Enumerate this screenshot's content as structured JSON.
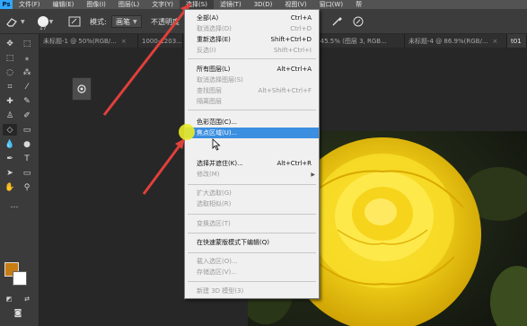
{
  "menubar": {
    "logo": "Ps",
    "items": [
      "文件(F)",
      "编辑(E)",
      "图像(I)",
      "图层(L)",
      "文字(Y)",
      "选择(S)",
      "滤镜(T)",
      "3D(D)",
      "视图(V)",
      "窗口(W)",
      "帮"
    ]
  },
  "options": {
    "brush_size": "17",
    "mode_label": "模式:",
    "mode_value": "画笔",
    "opacity_label": "不透明度"
  },
  "tabs": [
    {
      "label": "未标题-1 @ 50%(RGB/..."
    },
    {
      "label": "1000-1203..."
    },
    {
      "label": "...45.5% (图层 3, RGB..."
    },
    {
      "label": "未标题-4 @ 86.9%(RGB/..."
    },
    {
      "label": "t01"
    }
  ],
  "mini_panel_icon": "layer-comp-icon",
  "dropdown": {
    "items": [
      {
        "label": "全部(A)",
        "shortcut": "Ctrl+A",
        "disabled": false
      },
      {
        "label": "取消选择(D)",
        "shortcut": "Ctrl+D",
        "disabled": true
      },
      {
        "label": "重新选择(E)",
        "shortcut": "Shift+Ctrl+D",
        "disabled": false
      },
      {
        "label": "反选(I)",
        "shortcut": "Shift+Ctrl+I",
        "disabled": true
      },
      {
        "label": "所有图层(L)",
        "shortcut": "Alt+Ctrl+A",
        "disabled": false
      },
      {
        "label": "取消选择图层(S)",
        "shortcut": "",
        "disabled": true
      },
      {
        "label": "查找图层",
        "shortcut": "Alt+Shift+Ctrl+F",
        "disabled": true
      },
      {
        "label": "隔离图层",
        "shortcut": "",
        "disabled": true
      },
      {
        "label": "色彩范围(C)...",
        "shortcut": "",
        "disabled": false
      },
      {
        "label": "焦点区域(U)...",
        "shortcut": "",
        "disabled": false,
        "highlighted": true
      },
      {
        "label": "选择并遮住(K)...",
        "shortcut": "Alt+Ctrl+R",
        "disabled": false
      },
      {
        "label": "修改(M)",
        "shortcut": "",
        "disabled": true,
        "submenu": true
      },
      {
        "label": "扩大选取(G)",
        "shortcut": "",
        "disabled": true
      },
      {
        "label": "选取相似(R)",
        "shortcut": "",
        "disabled": true
      },
      {
        "label": "变换选区(T)",
        "shortcut": "",
        "disabled": true
      },
      {
        "label": "在快速蒙版模式下编辑(Q)",
        "shortcut": "",
        "disabled": false
      },
      {
        "label": "载入选区(O)...",
        "shortcut": "",
        "disabled": true
      },
      {
        "label": "存储选区(V)...",
        "shortcut": "",
        "disabled": true
      },
      {
        "label": "新建 3D 模型(3)",
        "shortcut": "",
        "disabled": true
      }
    ]
  },
  "colors": {
    "foreground": "#c77d14",
    "background": "#ffffff",
    "highlight": "#3b8ee0",
    "annotation_arrow": "#e0403a"
  }
}
